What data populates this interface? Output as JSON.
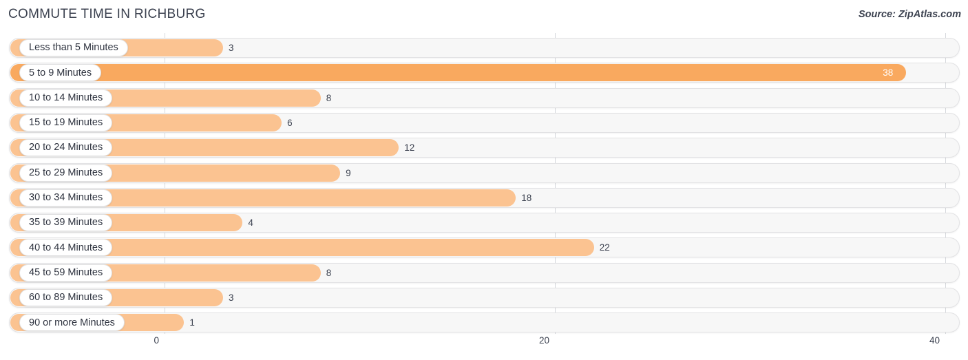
{
  "header": {
    "title": "COMMUTE TIME IN RICHBURG",
    "source": "Source: ZipAtlas.com"
  },
  "colors": {
    "bar": "#fbc391",
    "bar_highlight": "#f9a95f",
    "track": "#f7f7f7",
    "track_border": "#e2e2e4",
    "grid": "#d6d8dd",
    "text": "#3c4250",
    "value_inside": "#ffffff"
  },
  "chart_data": {
    "type": "bar",
    "orientation": "horizontal",
    "title": "COMMUTE TIME IN RICHBURG",
    "subtitle": "",
    "xlabel": "",
    "ylabel": "",
    "xlim": [
      0,
      40
    ],
    "xticks": [
      0,
      20,
      40
    ],
    "xtick_labels": [
      "0",
      "20",
      "40"
    ],
    "grid": true,
    "legend": false,
    "highlight_category": "5 to 9 Minutes",
    "categories": [
      "Less than 5 Minutes",
      "5 to 9 Minutes",
      "10 to 14 Minutes",
      "15 to 19 Minutes",
      "20 to 24 Minutes",
      "25 to 29 Minutes",
      "30 to 34 Minutes",
      "35 to 39 Minutes",
      "40 to 44 Minutes",
      "45 to 59 Minutes",
      "60 to 89 Minutes",
      "90 or more Minutes"
    ],
    "values": [
      3,
      38,
      8,
      6,
      12,
      9,
      18,
      4,
      22,
      8,
      3,
      1
    ],
    "value_labels": [
      "3",
      "38",
      "8",
      "6",
      "12",
      "9",
      "18",
      "4",
      "22",
      "8",
      "3",
      "1"
    ]
  }
}
